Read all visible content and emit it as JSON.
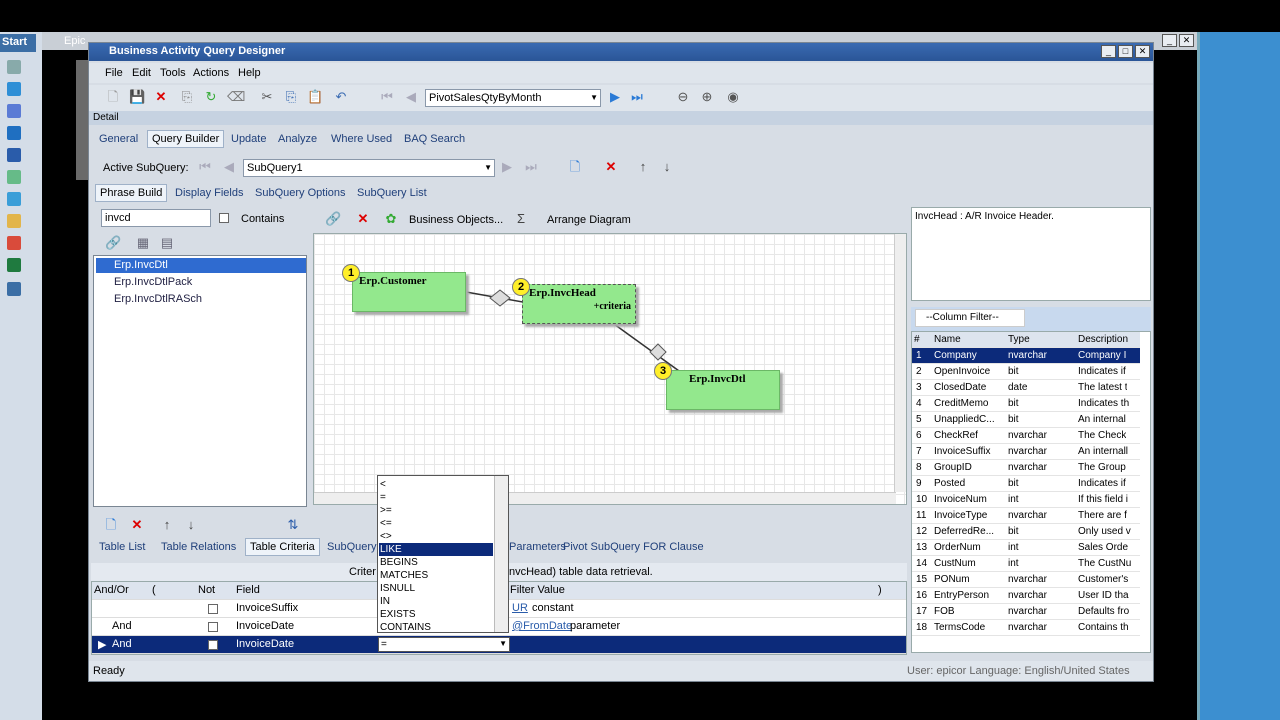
{
  "taskbar": {
    "start": "Start",
    "epic_tab": "Epic"
  },
  "window": {
    "title": "Business Activity Query Designer",
    "detail": "Detail"
  },
  "menu": [
    "File",
    "Edit",
    "Tools",
    "Actions",
    "Help"
  ],
  "toolbar": {
    "query_name": "PivotSalesQtyByMonth"
  },
  "tabs": [
    "General",
    "Query Builder",
    "Update",
    "Analyze",
    "Where Used",
    "BAQ Search"
  ],
  "subquery": {
    "label": "Active SubQuery:",
    "value": "SubQuery1"
  },
  "subtabs": [
    "Phrase Build",
    "Display Fields",
    "SubQuery Options",
    "SubQuery List"
  ],
  "search": {
    "value": "invcd",
    "contains_label": "Contains"
  },
  "tables_list": [
    "Erp.InvcDtl",
    "Erp.InvcDtlPack",
    "Erp.InvcDtlRASch"
  ],
  "diagram_toolbar": {
    "business_objects": "Business Objects...",
    "arrange": "Arrange Diagram"
  },
  "diagram": {
    "t1": "Erp.Customer",
    "t2": "Erp.InvcHead",
    "t2sub": "+criteria",
    "t3": "Erp.InvcDtl",
    "b1": "1",
    "b2": "2",
    "b3": "3"
  },
  "description": "InvcHead : A/R Invoice Header.",
  "column_filter": "--Column Filter--",
  "grid_headers": [
    "#",
    "Name",
    "Type",
    "Description"
  ],
  "grid_rows": [
    [
      "1",
      "Company",
      "nvarchar",
      "Company I"
    ],
    [
      "2",
      "OpenInvoice",
      "bit",
      "Indicates if"
    ],
    [
      "3",
      "ClosedDate",
      "date",
      "The latest t"
    ],
    [
      "4",
      "CreditMemo",
      "bit",
      "Indicates th"
    ],
    [
      "5",
      "UnappliedC...",
      "bit",
      "An internal"
    ],
    [
      "6",
      "CheckRef",
      "nvarchar",
      "The Check"
    ],
    [
      "7",
      "InvoiceSuffix",
      "nvarchar",
      "An internall"
    ],
    [
      "8",
      "GroupID",
      "nvarchar",
      "The Group"
    ],
    [
      "9",
      "Posted",
      "bit",
      "Indicates if"
    ],
    [
      "10",
      "InvoiceNum",
      "int",
      "If this field i"
    ],
    [
      "11",
      "InvoiceType",
      "nvarchar",
      "There are f"
    ],
    [
      "12",
      "DeferredRe...",
      "bit",
      "Only used v"
    ],
    [
      "13",
      "OrderNum",
      "int",
      "Sales Orde"
    ],
    [
      "14",
      "CustNum",
      "int",
      "The CustNu"
    ],
    [
      "15",
      "PONum",
      "nvarchar",
      "Customer's"
    ],
    [
      "16",
      "EntryPerson",
      "nvarchar",
      "User ID tha"
    ],
    [
      "17",
      "FOB",
      "nvarchar",
      "Defaults fro"
    ],
    [
      "18",
      "TermsCode",
      "nvarchar",
      "Contains th"
    ]
  ],
  "bottom_tabs": [
    "Table List",
    "Table Relations",
    "Table Criteria",
    "SubQuery",
    "Parameters",
    "Pivot SubQuery FOR Clause"
  ],
  "criteria_label_left": "Criter",
  "criteria_label_right": "nvcHead) table data retrieval.",
  "criteria_headers": [
    "And/Or",
    "(",
    "Not",
    "Field",
    "Filter Value",
    ")"
  ],
  "criteria_rows": [
    {
      "andor": "",
      "field": "InvoiceSuffix",
      "filter": "UR",
      "filter2": "constant"
    },
    {
      "andor": "And",
      "field": "InvoiceDate",
      "filter": "@FromDate",
      "filter2": "parameter"
    },
    {
      "andor": "And",
      "field": "InvoiceDate",
      "filter": "",
      "filter2": ""
    }
  ],
  "operators": [
    "<",
    "=",
    ">=",
    "<=",
    "<>",
    "LIKE",
    "BEGINS",
    "MATCHES",
    "ISNULL",
    "IN",
    "EXISTS",
    "CONTAINS"
  ],
  "operator_selected": "=",
  "status": "Ready",
  "footer": "User: epicor   Language: English/United States"
}
